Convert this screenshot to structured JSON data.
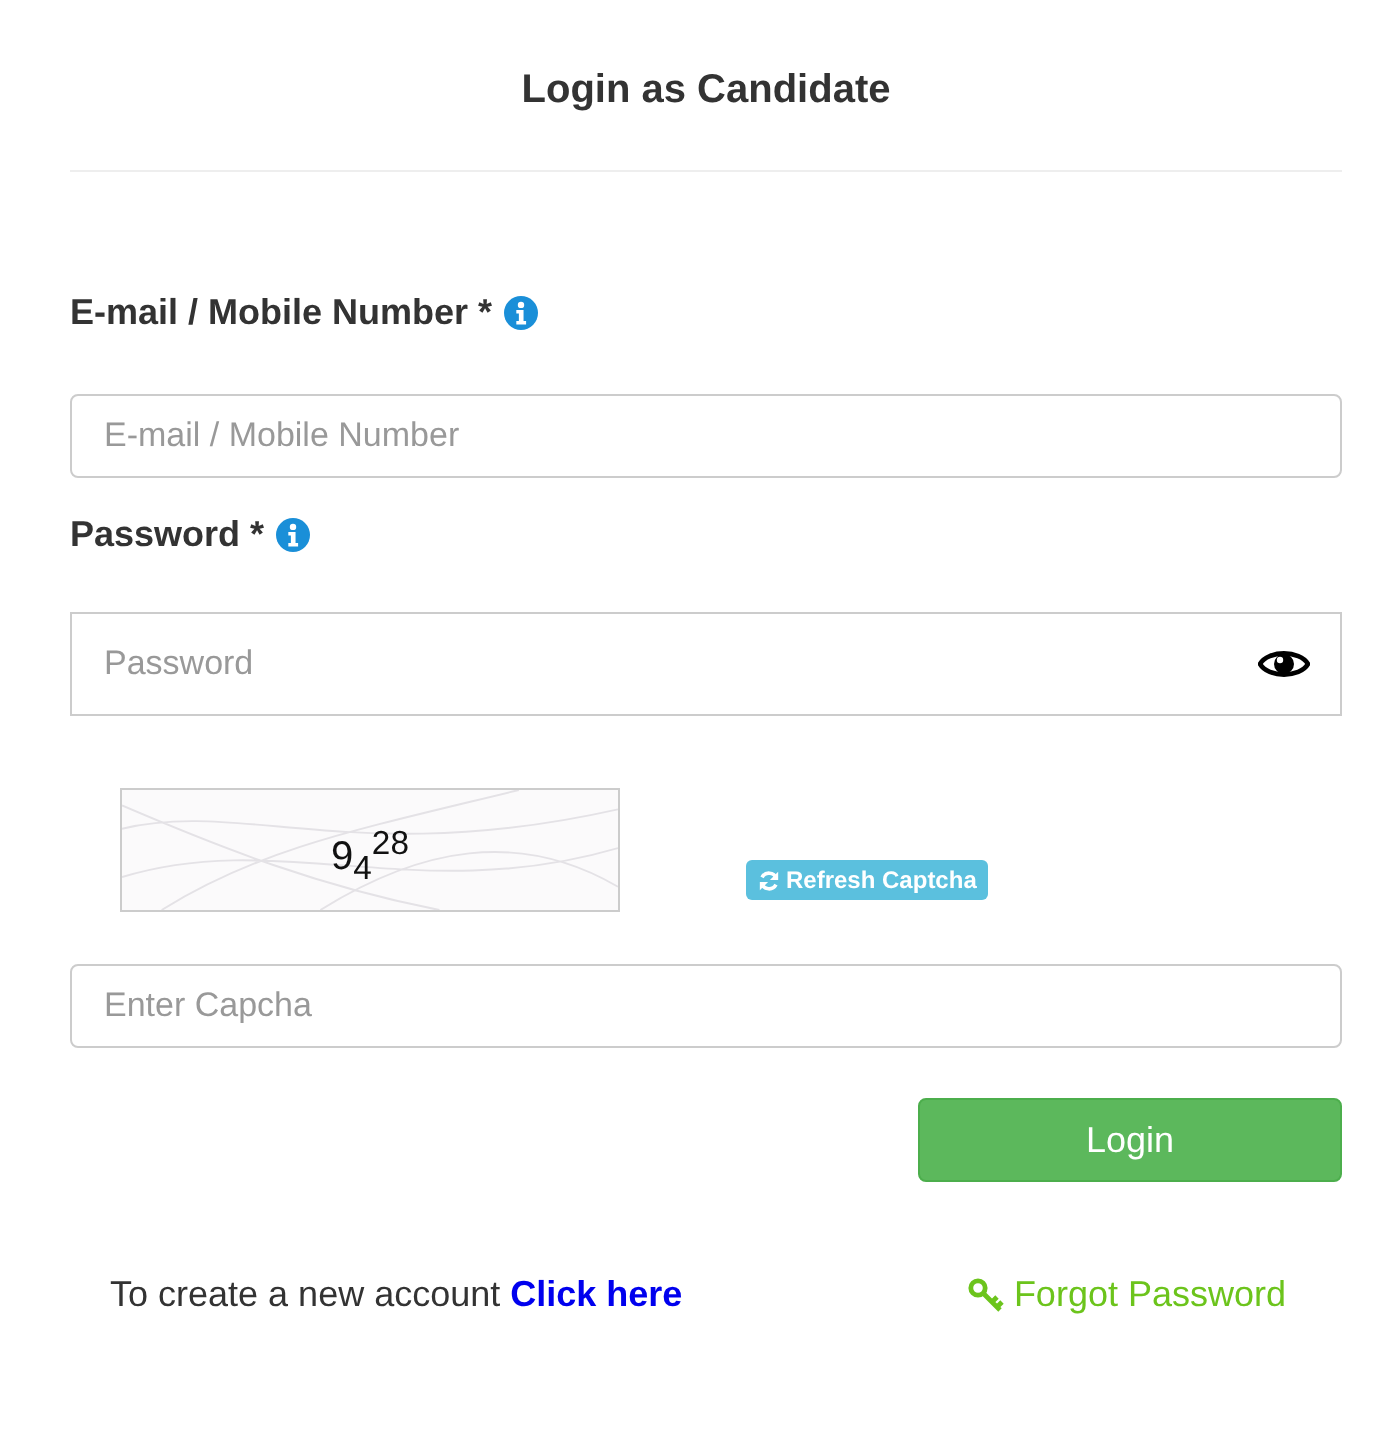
{
  "title": "Login as Candidate",
  "fields": [
    {
      "label": "E-mail / Mobile Number *",
      "placeholder": "E-mail / Mobile Number",
      "kind": "text"
    },
    {
      "label": "Password *",
      "placeholder": "Password",
      "kind": "password"
    }
  ],
  "captcha": {
    "code": "9$_{4}$$^{2}$$^{8}$",
    "refresh": "Refresh Captcha",
    "placeholder": "Enter Capcha"
  },
  "login_button": "Login",
  "footer": {
    "text": "To create a new account",
    "link": "Click here",
    "forgot": "Forgot Password"
  }
}
